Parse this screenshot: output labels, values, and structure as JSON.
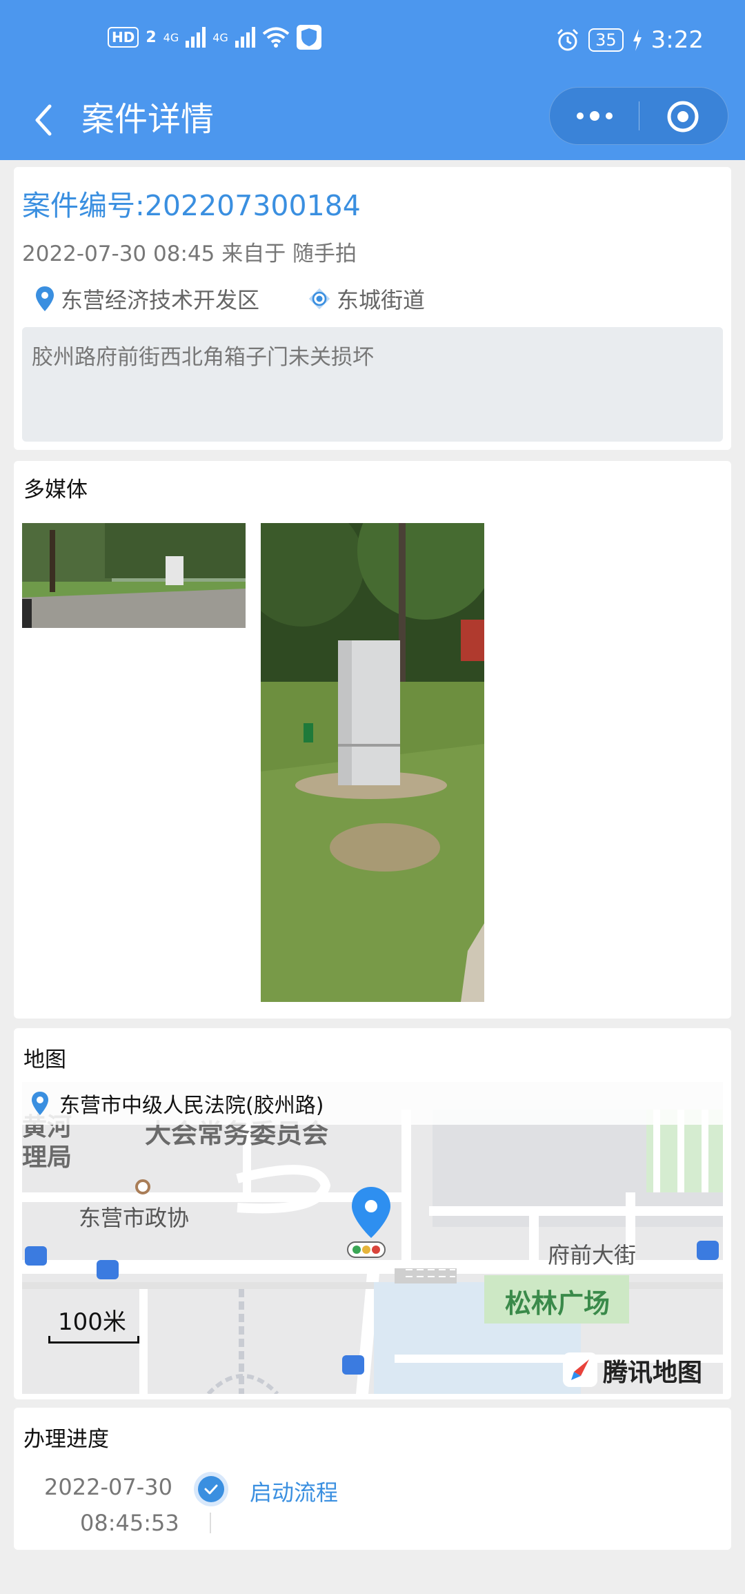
{
  "status_bar": {
    "hd": "HD",
    "sim": "2",
    "net1": "4G",
    "net2": "4G",
    "battery": "35",
    "time": "3:22"
  },
  "nav": {
    "title": "案件详情",
    "icons": [
      "back-icon",
      "more-icon",
      "record-icon"
    ]
  },
  "case": {
    "number": "案件编号:202207300184",
    "meta": "2022-07-30 08:45 来自于 随手拍",
    "district": "东营经济技术开发区",
    "street": "东城街道",
    "description": "胶州路府前街西北角箱子门未关损坏"
  },
  "media": {
    "title": "多媒体"
  },
  "map": {
    "title": "地图",
    "location": "东营市中级人民法院(胶州路)",
    "labels": {
      "faded_left": "黄河\n理局",
      "faded_top": "大会常务委员会",
      "zhengxie": "东营市政协",
      "road": "府前大街",
      "square": "松林广场"
    },
    "scale": "100米",
    "brand": "腾讯地图"
  },
  "progress": {
    "title": "办理进度",
    "items": [
      {
        "date": "2022-07-30",
        "time": "08:45:53",
        "step": "启动流程"
      }
    ]
  },
  "colors": {
    "brand_blue": "#4c97ee",
    "link_blue": "#3a8fe0",
    "page_bg": "#eeeeee"
  }
}
